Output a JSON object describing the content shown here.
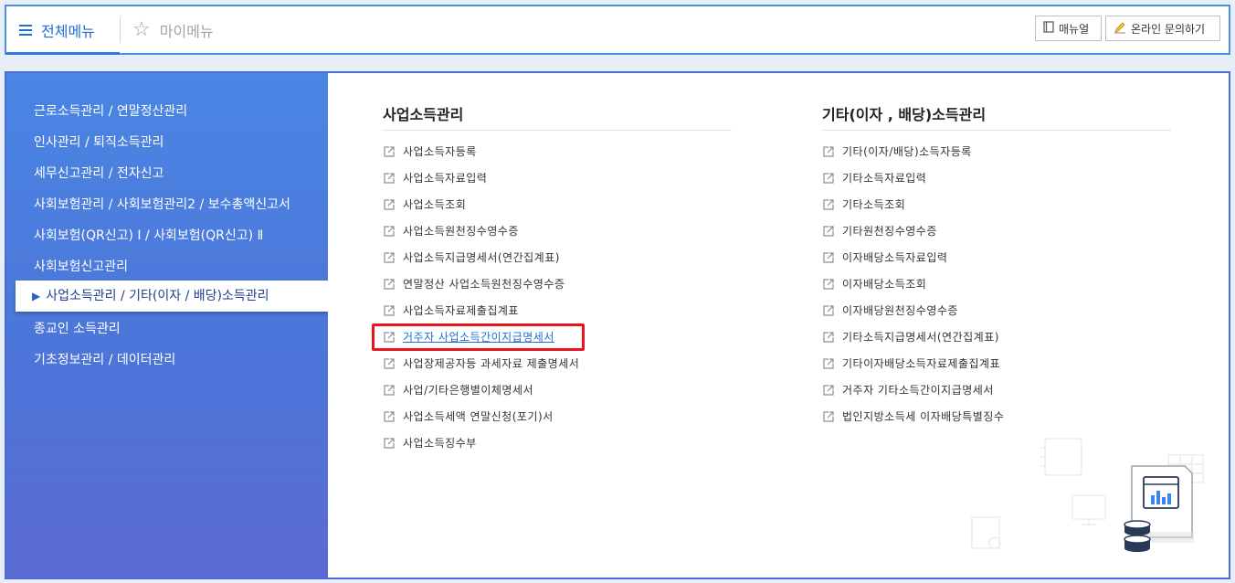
{
  "topbar": {
    "tab_all_label": "전체메뉴",
    "tab_my_label": "마이메뉴",
    "manual_button": "매뉴얼",
    "online_inquiry_button": "온라인 문의하기"
  },
  "sidebar": {
    "items": [
      "근로소득관리 / 연말정산관리",
      "인사관리 / 퇴직소득관리",
      "세무신고관리 / 전자신고",
      "사회보험관리 / 사회보험관리2 / 보수총액신고서",
      "사회보험(QR신고) Ⅰ / 사회보험(QR신고) Ⅱ",
      "사회보험신고관리",
      "사업소득관리 / 기타(이자 / 배당)소득관리",
      "종교인 소득관리",
      "기초정보관리 / 데이터관리"
    ],
    "active_index": 6
  },
  "content": {
    "left_column": {
      "title": "사업소득관리",
      "links": [
        "사업소득자등록",
        "사업소득자료입력",
        "사업소득조회",
        "사업소득원천징수영수증",
        "사업소득지급명세서(연간집계표)",
        "연말정산 사업소득원천징수영수증",
        "사업소득자료제출집계표",
        "거주자 사업소득간이지급명세서",
        "사업장제공자등 과세자료 제출명세서",
        "사업/기타은행별이체명세서",
        "사업소득세액 연말신청(포기)서",
        "사업소득징수부"
      ],
      "highlighted_index": 7
    },
    "right_column": {
      "title": "기타(이자 , 배당)소득관리",
      "links": [
        "기타(이자/배당)소득자등록",
        "기타소득자료입력",
        "기타소득조회",
        "기타원천징수영수증",
        "이자배당소득자료입력",
        "이자배당소득조회",
        "이자배당원천징수영수증",
        "기타소득지급명세서(연간집계표)",
        "기타이자배당소득자료제출집계표",
        "거주자 기타소득간이지급명세서",
        "법인지방소득세 이자배당특별징수"
      ]
    }
  },
  "colors": {
    "accent": "#2c7be5",
    "highlight_border": "#e8161b",
    "sidebar_top": "#4a86e3",
    "sidebar_bottom": "#5a6ad3"
  },
  "icons": [
    "hamburger-icon",
    "star-icon",
    "book-icon",
    "pencil-icon",
    "external-link-icon",
    "triangle-right-icon"
  ]
}
